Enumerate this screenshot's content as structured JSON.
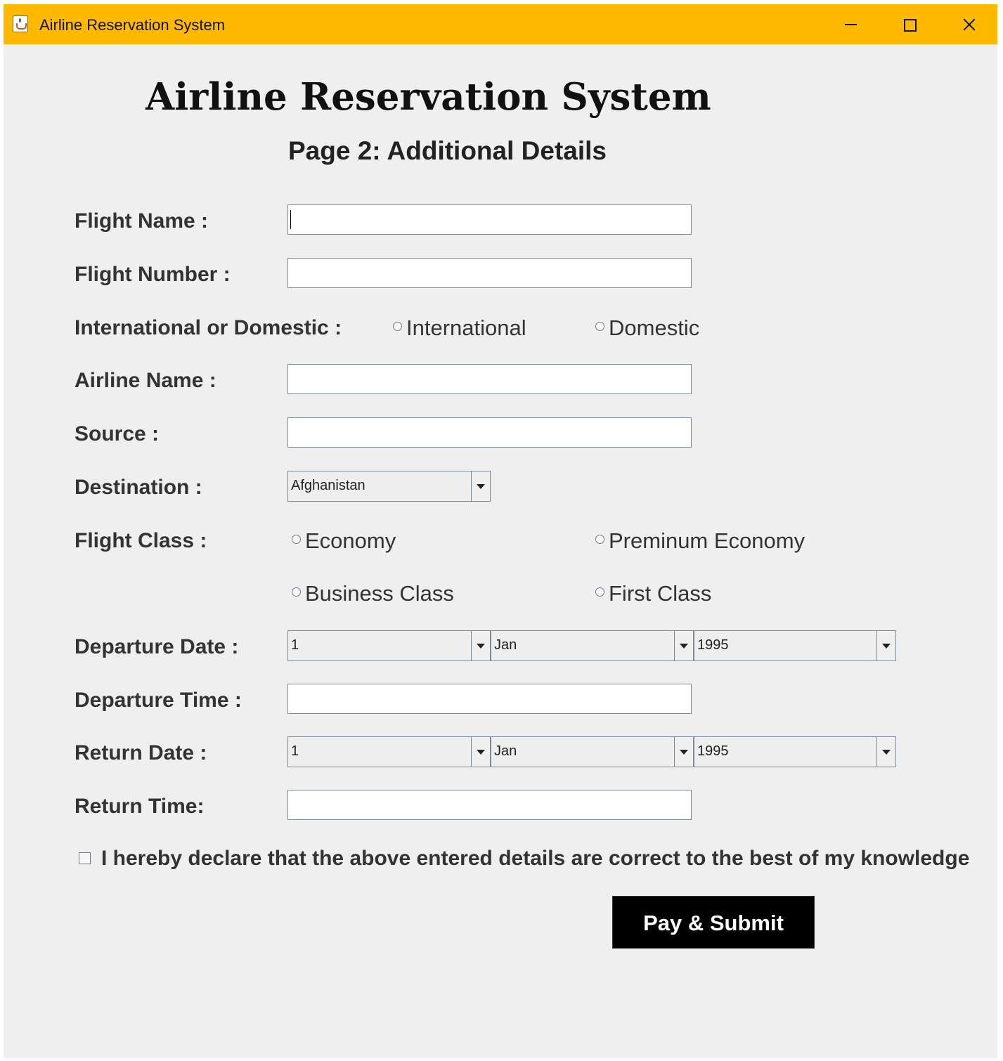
{
  "window": {
    "title": "Airline Reservation System"
  },
  "header": {
    "title": "Airline Reservation System",
    "subtitle": "Page 2: Additional Details"
  },
  "form": {
    "flight_name": {
      "label": "Flight Name :",
      "value": ""
    },
    "flight_number": {
      "label": "Flight Number :",
      "value": ""
    },
    "intl_domestic": {
      "label": "International or Domestic :",
      "options": [
        "International",
        "Domestic"
      ],
      "selected": null
    },
    "airline_name": {
      "label": "Airline Name :",
      "value": ""
    },
    "source": {
      "label": "Source :",
      "value": ""
    },
    "destination": {
      "label": "Destination :",
      "selected": "Afghanistan"
    },
    "flight_class": {
      "label": "Flight Class :",
      "options": [
        "Economy",
        "Preminum Economy",
        "Business Class",
        "First Class"
      ],
      "selected": null
    },
    "departure_date": {
      "label": "Departure Date :",
      "day": "1",
      "month": "Jan",
      "year": "1995"
    },
    "departure_time": {
      "label": "Departure Time :",
      "value": ""
    },
    "return_date": {
      "label": "Return Date :",
      "day": "1",
      "month": "Jan",
      "year": "1995"
    },
    "return_time": {
      "label": "Return Time:",
      "value": ""
    },
    "declaration": {
      "text": "I hereby declare that the above entered details are correct to the best of my knowledge",
      "checked": false
    },
    "submit_label": "Pay & Submit"
  },
  "colors": {
    "titlebar": "#ffba00",
    "background": "#efefef",
    "button": "#000000",
    "button_text": "#ffffff"
  },
  "icons": [
    "java-cup-icon",
    "minimize-icon",
    "maximize-icon",
    "close-icon",
    "chevron-down-icon"
  ]
}
